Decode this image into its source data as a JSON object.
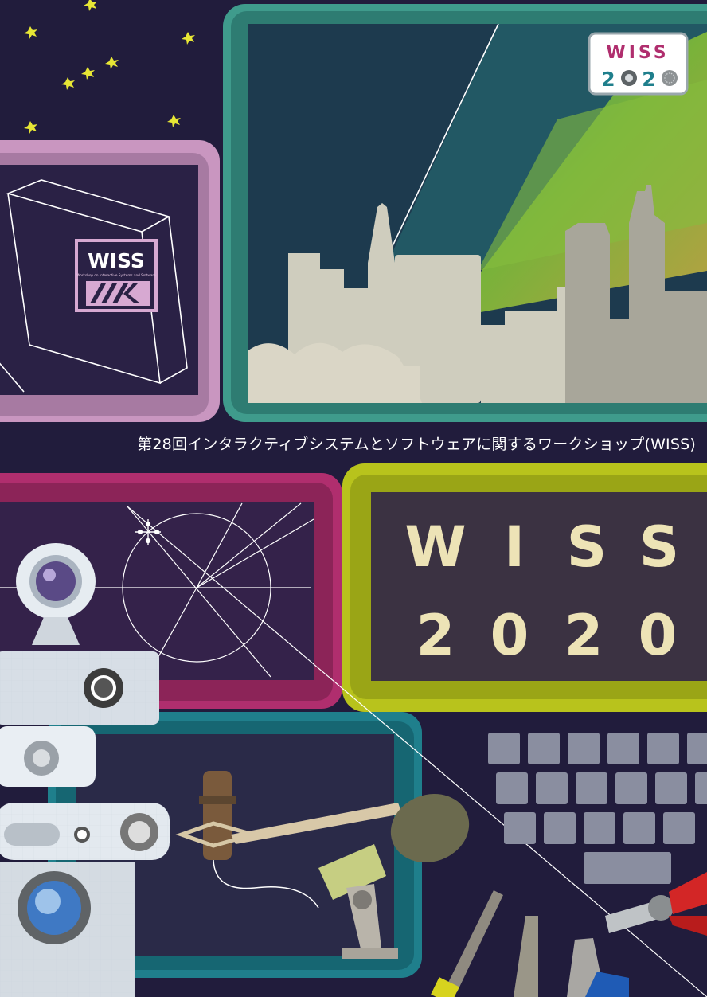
{
  "subtitle": "第28回インタラクティブシステムとソフトウェアに関するワークショップ(WISS)",
  "corner_logo": {
    "top": "WISS",
    "bottom_digits": [
      "2",
      "2"
    ],
    "icon_left": "camera-lens-icon",
    "icon_right": "speaker-grille-icon"
  },
  "cube_logo": {
    "title": "WISS",
    "tagline": "Workshop on Interactive Systems and Software",
    "mark": "wiss-chevron-mark-icon"
  },
  "big_title": {
    "letters": [
      "W",
      "I",
      "S",
      "S"
    ],
    "digits": [
      "2",
      "0",
      "2",
      "0"
    ]
  },
  "colors": {
    "background": "#211c3c",
    "teal_frame": "#3f9b8c",
    "pink_frame": "#c996c0",
    "magenta_frame": "#b02e6e",
    "lime_frame": "#b8c31c",
    "blue_frame": "#1f7f8c",
    "title_cream": "#ede3b6",
    "star_yellow": "#e7e635"
  }
}
